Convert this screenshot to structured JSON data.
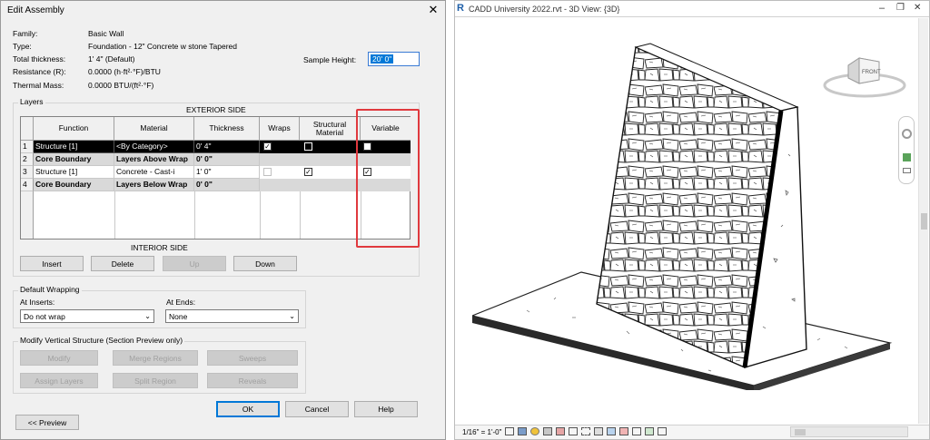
{
  "dialog": {
    "title": "Edit Assembly",
    "close_glyph": "✕",
    "props": {
      "family_label": "Family:",
      "family_value": "Basic Wall",
      "type_label": "Type:",
      "type_value": "Foundation - 12\" Concrete w stone Tapered",
      "thickness_label": "Total thickness:",
      "thickness_value": "1'  4\" (Default)",
      "resistance_label": "Resistance (R):",
      "resistance_value": "0.0000 (h·ft²·°F)/BTU",
      "mass_label": "Thermal Mass:",
      "mass_value": "0.0000 BTU/(ft²·°F)",
      "sample_height_label": "Sample Height:",
      "sample_height_value": "20'  0\""
    },
    "layers": {
      "group_label": "Layers",
      "exterior_label": "EXTERIOR SIDE",
      "interior_label": "INTERIOR SIDE",
      "headers": [
        "Function",
        "Material",
        "Thickness",
        "Wraps",
        "Structural Material",
        "Variable"
      ],
      "rows": [
        {
          "num": "1",
          "function": "Structure [1]",
          "material": "<By Category>",
          "thickness": "0'  4\"",
          "wraps": true,
          "structural": true,
          "variable": false
        },
        {
          "num": "2",
          "function": "Core Boundary",
          "material": "Layers Above Wrap",
          "thickness": "0'  0\""
        },
        {
          "num": "3",
          "function": "Structure [1]",
          "material": "Concrete - Cast-i",
          "thickness": "1'  0\"",
          "wraps": false,
          "structural": true,
          "variable": true
        },
        {
          "num": "4",
          "function": "Core Boundary",
          "material": "Layers Below Wrap",
          "thickness": "0'  0\""
        }
      ],
      "check_glyph": "✓",
      "insert": "Insert",
      "delete": "Delete",
      "up": "Up",
      "down": "Down"
    },
    "wrapping": {
      "group_label": "Default Wrapping",
      "at_inserts_label": "At Inserts:",
      "at_inserts_value": "Do not wrap",
      "at_ends_label": "At Ends:",
      "at_ends_value": "None",
      "arrow": "⌄"
    },
    "modify": {
      "group_label": "Modify Vertical Structure (Section Preview only)",
      "modify": "Modify",
      "merge": "Merge Regions",
      "sweeps": "Sweeps",
      "assign": "Assign Layers",
      "split": "Split Region",
      "reveals": "Reveals"
    },
    "footer": {
      "ok": "OK",
      "cancel": "Cancel",
      "help": "Help",
      "preview": "<< Preview"
    }
  },
  "view": {
    "app_letter": "R",
    "title": "CADD University 2022.rvt - 3D View: {3D}",
    "minimize": "–",
    "restore": "❐",
    "close": "✕",
    "viewcube_label": "FRONT",
    "scale_text": "1/16\" = 1'-0\"",
    "highlight_color": "#e0393e"
  }
}
